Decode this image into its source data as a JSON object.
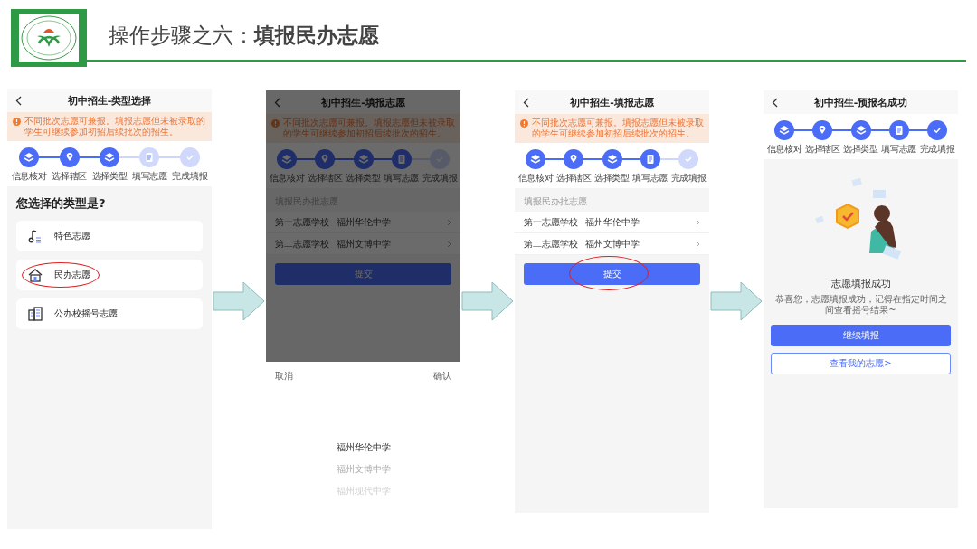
{
  "header": {
    "title": "操作步骤之六：**填报民办志愿**"
  },
  "screens": [
    {
      "kind": "type_select",
      "dimmed": false,
      "title": "初中招生-类型选择",
      "notice": "不同批次志愿可兼报。填报志愿但未被录取的学生可继续参加初招后续批次的招生。",
      "steps": [
        {
          "label": "信息核对",
          "done": true
        },
        {
          "label": "选择辖区",
          "done": true
        },
        {
          "label": "选择类型",
          "done": true
        },
        {
          "label": "填写志愿",
          "done": false
        },
        {
          "label": "完成填报",
          "done": false
        }
      ],
      "question": "您选择的类型是?",
      "options": [
        {
          "label": "特色志愿",
          "highlighted": false
        },
        {
          "label": "民办志愿",
          "highlighted": true
        },
        {
          "label": "公办校摇号志愿",
          "highlighted": false
        }
      ]
    },
    {
      "kind": "fill_form",
      "dimmed": true,
      "title": "初中招生-填报志愿",
      "notice": "不同批次志愿可兼报。填报志愿但未被录取的学生可继续参加初招后续批次的招生。",
      "steps": [
        {
          "label": "信息核对",
          "done": true
        },
        {
          "label": "选择辖区",
          "done": true
        },
        {
          "label": "选择类型",
          "done": true
        },
        {
          "label": "填写志愿",
          "done": true
        },
        {
          "label": "完成填报",
          "done": false
        }
      ],
      "section": "填报民办批志愿",
      "rows": [
        {
          "label": "第一志愿学校",
          "value": "福州华伦中学"
        },
        {
          "label": "第二志愿学校",
          "value": "福州文博中学"
        }
      ],
      "submit": {
        "label": "提交",
        "highlighted": false
      },
      "picker": {
        "cancel": "取消",
        "confirm": "确认",
        "options": [
          {
            "label": "福州华伦中学",
            "selected": true
          },
          {
            "label": "福州文博中学",
            "selected": false
          },
          {
            "label": "福州现代中学",
            "selected": false
          }
        ]
      }
    },
    {
      "kind": "fill_form",
      "dimmed": false,
      "title": "初中招生-填报志愿",
      "notice": "不同批次志愿可兼报。填报志愿但未被录取的学生可继续参加初招后续批次的招生。",
      "steps": [
        {
          "label": "信息核对",
          "done": true
        },
        {
          "label": "选择辖区",
          "done": true
        },
        {
          "label": "选择类型",
          "done": true
        },
        {
          "label": "填写志愿",
          "done": true
        },
        {
          "label": "完成填报",
          "done": false
        }
      ],
      "section": "填报民办批志愿",
      "rows": [
        {
          "label": "第一志愿学校",
          "value": "福州华伦中学"
        },
        {
          "label": "第二志愿学校",
          "value": "福州文博中学"
        }
      ],
      "submit": {
        "label": "提交",
        "highlighted": true
      }
    },
    {
      "kind": "success",
      "dimmed": false,
      "title": "初中招生-预报名成功",
      "steps": [
        {
          "label": "信息核对",
          "done": true
        },
        {
          "label": "选择辖区",
          "done": true
        },
        {
          "label": "选择类型",
          "done": true
        },
        {
          "label": "填写志愿",
          "done": true
        },
        {
          "label": "完成填报",
          "done": true
        }
      ],
      "heading": "志愿填报成功",
      "message": "恭喜您，志愿填报成功，记得在指定时间之间查看摇号结果~",
      "primary": "继续填报",
      "secondary": "查看我的志愿>"
    }
  ]
}
